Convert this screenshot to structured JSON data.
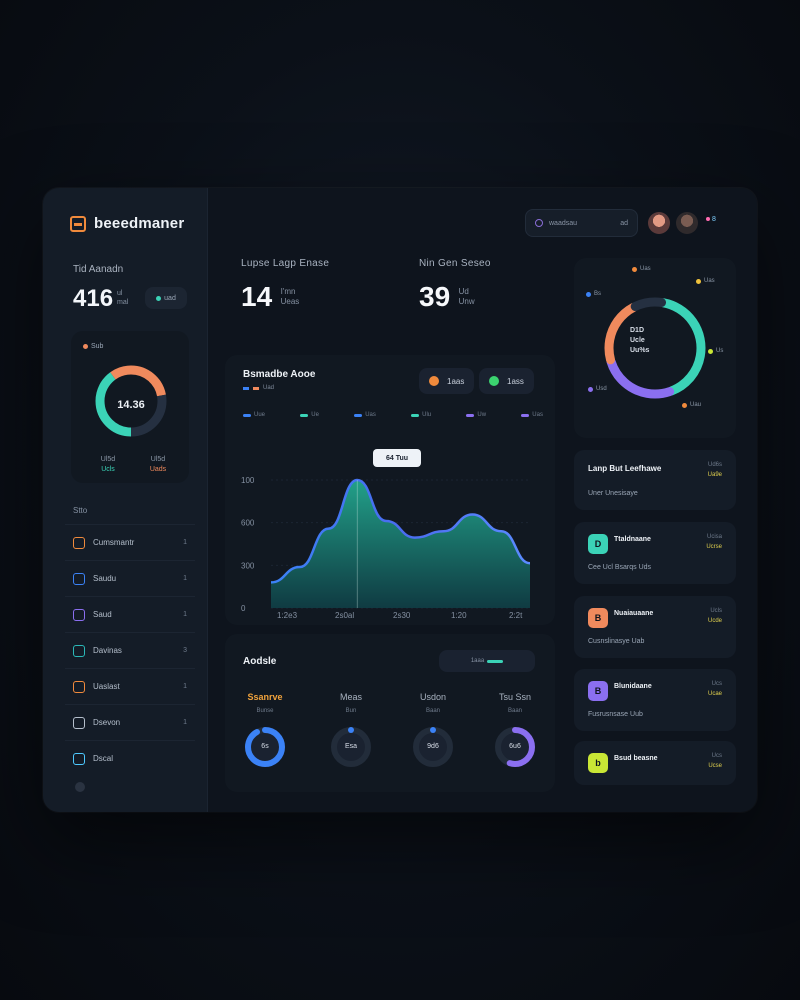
{
  "app": {
    "brand_name": "beeedmaner"
  },
  "topbar": {
    "search_placeholder": "waadsau",
    "search_hint": "ad",
    "notif_text": "8"
  },
  "sidebar": {
    "stat_label": "Tid Aanadn",
    "stat_value": "416",
    "stat_unit_1": "ul",
    "stat_unit_2": "mal",
    "stat_pill": "uad",
    "donut": {
      "tag": "Sub",
      "center_value": "14.36",
      "legend": [
        "Ul5d",
        "Ul5d",
        "Ucls",
        "Uads"
      ],
      "segments": [
        {
          "label": "teal",
          "value": 40,
          "color": "#3bd3b7"
        },
        {
          "label": "orange",
          "value": 32,
          "color": "#f08a5d"
        },
        {
          "label": "rest",
          "value": 28,
          "color": "#253041"
        }
      ]
    },
    "menu_title": "Stto",
    "menu": [
      {
        "label": "Cumsmantr",
        "count": "1",
        "color": "#f08a3c"
      },
      {
        "label": "Saudu",
        "count": "1",
        "color": "#3b82f6"
      },
      {
        "label": "Saud",
        "count": "1",
        "color": "#8b6ff0"
      },
      {
        "label": "Davinas",
        "count": "3",
        "color": "#2bb8b8"
      },
      {
        "label": "Uaslast",
        "count": "1",
        "color": "#f08a3c"
      },
      {
        "label": "Dsevon",
        "count": "1",
        "color": "#b5bfcc"
      },
      {
        "label": "Dscal",
        "count": "",
        "color": "#4ec9ff"
      }
    ]
  },
  "kpis": [
    {
      "label": "Lupse  Lagp  Enase",
      "value": "14",
      "unit_1": "I'mn",
      "unit_2": "Ueas"
    },
    {
      "label": "Nin  Gen  Seseo",
      "value": "39",
      "unit_1": "Ud",
      "unit_2": "Unw"
    }
  ],
  "main_chart": {
    "title": "Bsmadbe Aooe",
    "subtitle": "Uad",
    "btn_1": "1aas",
    "btn_2": "1ass",
    "tooltip": "64 Tuu",
    "legend": [
      "Uue",
      "Ue",
      "Uas",
      "Ulu",
      "Uw",
      "Uas"
    ],
    "legend_colors": [
      "#3b82f6",
      "#3bd3b7",
      "#3b82f6",
      "#3bd3b7",
      "#8b6ff0",
      "#8b6ff0"
    ]
  },
  "chart_data": {
    "type": "area",
    "x": [
      "1:2e3",
      "2s0al",
      "2s30",
      "1:20",
      "2:2t"
    ],
    "ylim": [
      0,
      100
    ],
    "y_ticks": [
      "0",
      "300",
      "600",
      "100"
    ],
    "series": [
      {
        "values": [
          20,
          32,
          62,
          100,
          68,
          55,
          60,
          73,
          60,
          35
        ]
      }
    ],
    "xlabel": "",
    "ylabel": "",
    "grid": true
  },
  "activity": {
    "title": "Aodsle",
    "pill_text": "1aaa",
    "cols": [
      {
        "label": "Ssanrve",
        "sub": "Bunse",
        "value": "6s",
        "pct": 0.92,
        "color": "#3b82f6",
        "color2": "#4ec9ff",
        "highlight": true
      },
      {
        "label": "Meas",
        "sub": "Bun",
        "value": "Esa",
        "pct": 0,
        "color": "#3b82f6",
        "color2": "#4ec9ff",
        "highlight": false
      },
      {
        "label": "Usdon",
        "sub": "Baan",
        "value": "9d6",
        "pct": 0,
        "color": "#3b82f6",
        "color2": "#4ec9ff",
        "highlight": false
      },
      {
        "label": "Tsu  Ssn",
        "sub": "Baan",
        "value": "6u6",
        "pct": 0.55,
        "color": "#8b6ff0",
        "color2": "#a78bfa",
        "highlight": false
      }
    ]
  },
  "ring_card": {
    "center": [
      "D1D",
      "Ucle",
      "Uu%s"
    ],
    "labels": [
      "Uas",
      "Bs",
      "Uas",
      "Us",
      "Usd",
      "Uau"
    ],
    "segments": [
      {
        "value": 42,
        "color": "#3bd3b7"
      },
      {
        "value": 26,
        "color": "#8b6ff0"
      },
      {
        "value": 22,
        "color": "#f08a5d"
      },
      {
        "value": 10,
        "color": "#253041"
      }
    ]
  },
  "right_cards": [
    {
      "title": "Lanp But Leefhawe",
      "sub": "Uner Unesisaye",
      "meta_1": "Ud6s",
      "meta_2": "Ua9e"
    },
    {
      "name": "Ttaldnaane",
      "desc": "Cee  Ucl Bsarqs   Uds",
      "meta_1": "Ucisa",
      "meta_2": "Ucrse",
      "icon_color": "#3bd3b7",
      "icon": "D"
    },
    {
      "name": "Nuaiauaane",
      "desc": "Cusnslinasye   Uab",
      "meta_1": "Ucls",
      "meta_2": "Ucde",
      "icon_color": "#f08a5d",
      "icon": "B"
    },
    {
      "name": "Blunidaane",
      "desc": "Fusrusnsase   Uub",
      "meta_1": "Ucs",
      "meta_2": "Ucae",
      "icon_color": "#8b6ff0",
      "icon": "B"
    },
    {
      "name": "Bsud beasne",
      "desc": "",
      "meta_1": "Ucs",
      "meta_2": "Ucse",
      "icon_color": "#c9e635",
      "icon": "b"
    }
  ]
}
